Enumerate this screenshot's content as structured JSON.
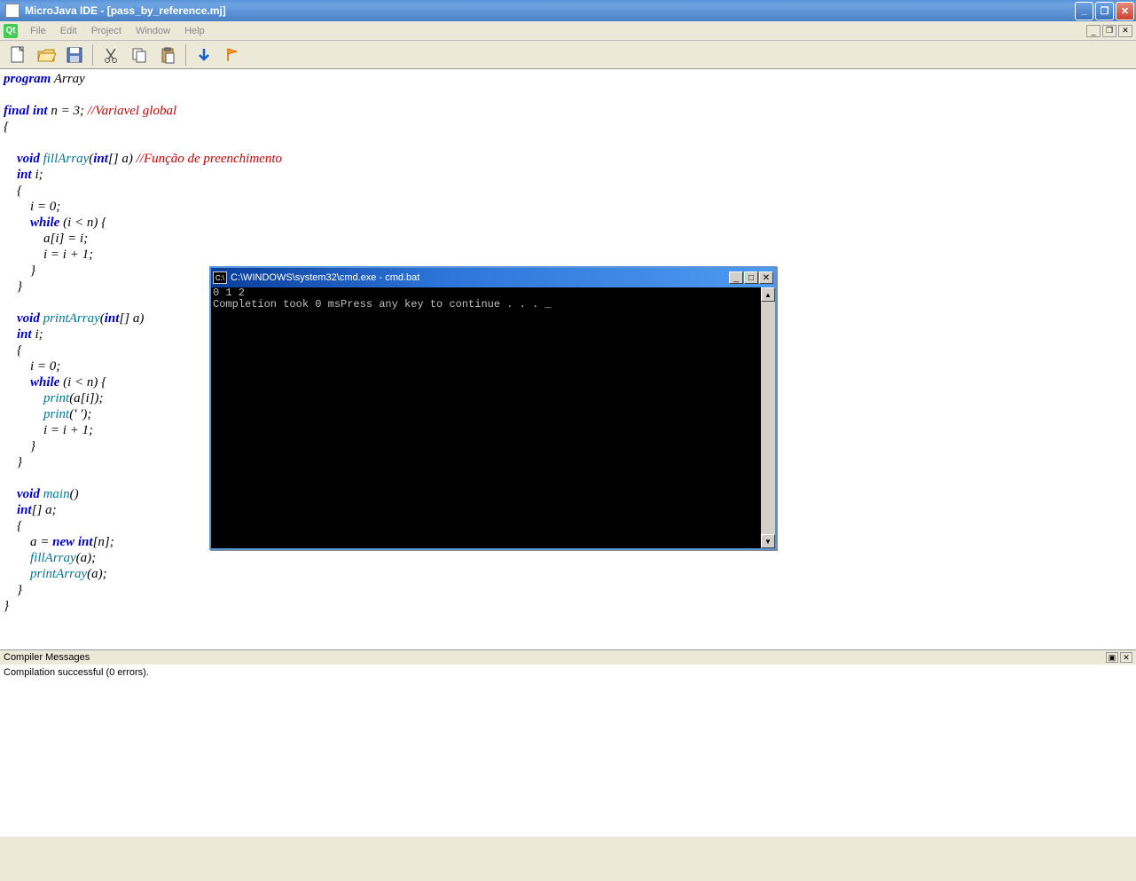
{
  "window": {
    "title": "MicroJava IDE - [pass_by_reference.mj]"
  },
  "menu": {
    "file": "File",
    "edit": "Edit",
    "project": "Project",
    "window": "Window",
    "help": "Help"
  },
  "code": {
    "tokens": [
      [
        [
          "program",
          "kw"
        ],
        [
          " Array",
          ""
        ]
      ],
      [
        [
          "",
          ""
        ]
      ],
      [
        [
          "final int",
          "kw"
        ],
        [
          " n = 3; ",
          ""
        ],
        [
          "//Variavel global",
          "comment"
        ]
      ],
      [
        [
          "{",
          ""
        ]
      ],
      [
        [
          "",
          ""
        ]
      ],
      [
        [
          "    ",
          ""
        ],
        [
          "void",
          "kw"
        ],
        [
          " ",
          ""
        ],
        [
          "fillArray",
          "ident"
        ],
        [
          "(",
          ""
        ],
        [
          "int",
          "kw"
        ],
        [
          "[] a) ",
          ""
        ],
        [
          "//Função de preenchimento",
          "comment"
        ]
      ],
      [
        [
          "    ",
          ""
        ],
        [
          "int",
          "kw"
        ],
        [
          " i;",
          ""
        ]
      ],
      [
        [
          "    {",
          ""
        ]
      ],
      [
        [
          "        i = 0;",
          ""
        ]
      ],
      [
        [
          "        ",
          ""
        ],
        [
          "while",
          "kw"
        ],
        [
          " (i < n) {",
          ""
        ]
      ],
      [
        [
          "            a[i] = i;",
          ""
        ]
      ],
      [
        [
          "            i = i + 1;",
          ""
        ]
      ],
      [
        [
          "        }",
          ""
        ]
      ],
      [
        [
          "    }",
          ""
        ]
      ],
      [
        [
          "",
          ""
        ]
      ],
      [
        [
          "    ",
          ""
        ],
        [
          "void",
          "kw"
        ],
        [
          " ",
          ""
        ],
        [
          "printArray",
          "ident"
        ],
        [
          "(",
          ""
        ],
        [
          "int",
          "kw"
        ],
        [
          "[] a)",
          ""
        ]
      ],
      [
        [
          "    ",
          ""
        ],
        [
          "int",
          "kw"
        ],
        [
          " i;",
          ""
        ]
      ],
      [
        [
          "    {",
          ""
        ]
      ],
      [
        [
          "        i = 0;",
          ""
        ]
      ],
      [
        [
          "        ",
          ""
        ],
        [
          "while",
          "kw"
        ],
        [
          " (i < n) {",
          ""
        ]
      ],
      [
        [
          "            ",
          ""
        ],
        [
          "print",
          "ident"
        ],
        [
          "(a[i]);",
          ""
        ]
      ],
      [
        [
          "            ",
          ""
        ],
        [
          "print",
          "ident"
        ],
        [
          "(' ');",
          ""
        ]
      ],
      [
        [
          "            i = i + 1;",
          ""
        ]
      ],
      [
        [
          "        }",
          ""
        ]
      ],
      [
        [
          "    }",
          ""
        ]
      ],
      [
        [
          "",
          ""
        ]
      ],
      [
        [
          "    ",
          ""
        ],
        [
          "void",
          "kw"
        ],
        [
          " ",
          ""
        ],
        [
          "main",
          "ident"
        ],
        [
          "()",
          ""
        ]
      ],
      [
        [
          "    ",
          ""
        ],
        [
          "int",
          "kw"
        ],
        [
          "[] a;",
          ""
        ]
      ],
      [
        [
          "    {",
          ""
        ]
      ],
      [
        [
          "        a = ",
          ""
        ],
        [
          "new int",
          "kw"
        ],
        [
          "[n];",
          ""
        ]
      ],
      [
        [
          "        ",
          ""
        ],
        [
          "fillArray",
          "ident"
        ],
        [
          "(a);",
          ""
        ]
      ],
      [
        [
          "        ",
          ""
        ],
        [
          "printArray",
          "ident"
        ],
        [
          "(a);",
          ""
        ]
      ],
      [
        [
          "    }",
          ""
        ]
      ],
      [
        [
          "}",
          ""
        ]
      ]
    ]
  },
  "compiler": {
    "title": "Compiler Messages",
    "message": "Compilation successful (0 errors)."
  },
  "console": {
    "title": "C:\\WINDOWS\\system32\\cmd.exe - cmd.bat",
    "line1": "0 1 2",
    "line2": "Completion took 0 msPress any key to continue . . . _"
  }
}
